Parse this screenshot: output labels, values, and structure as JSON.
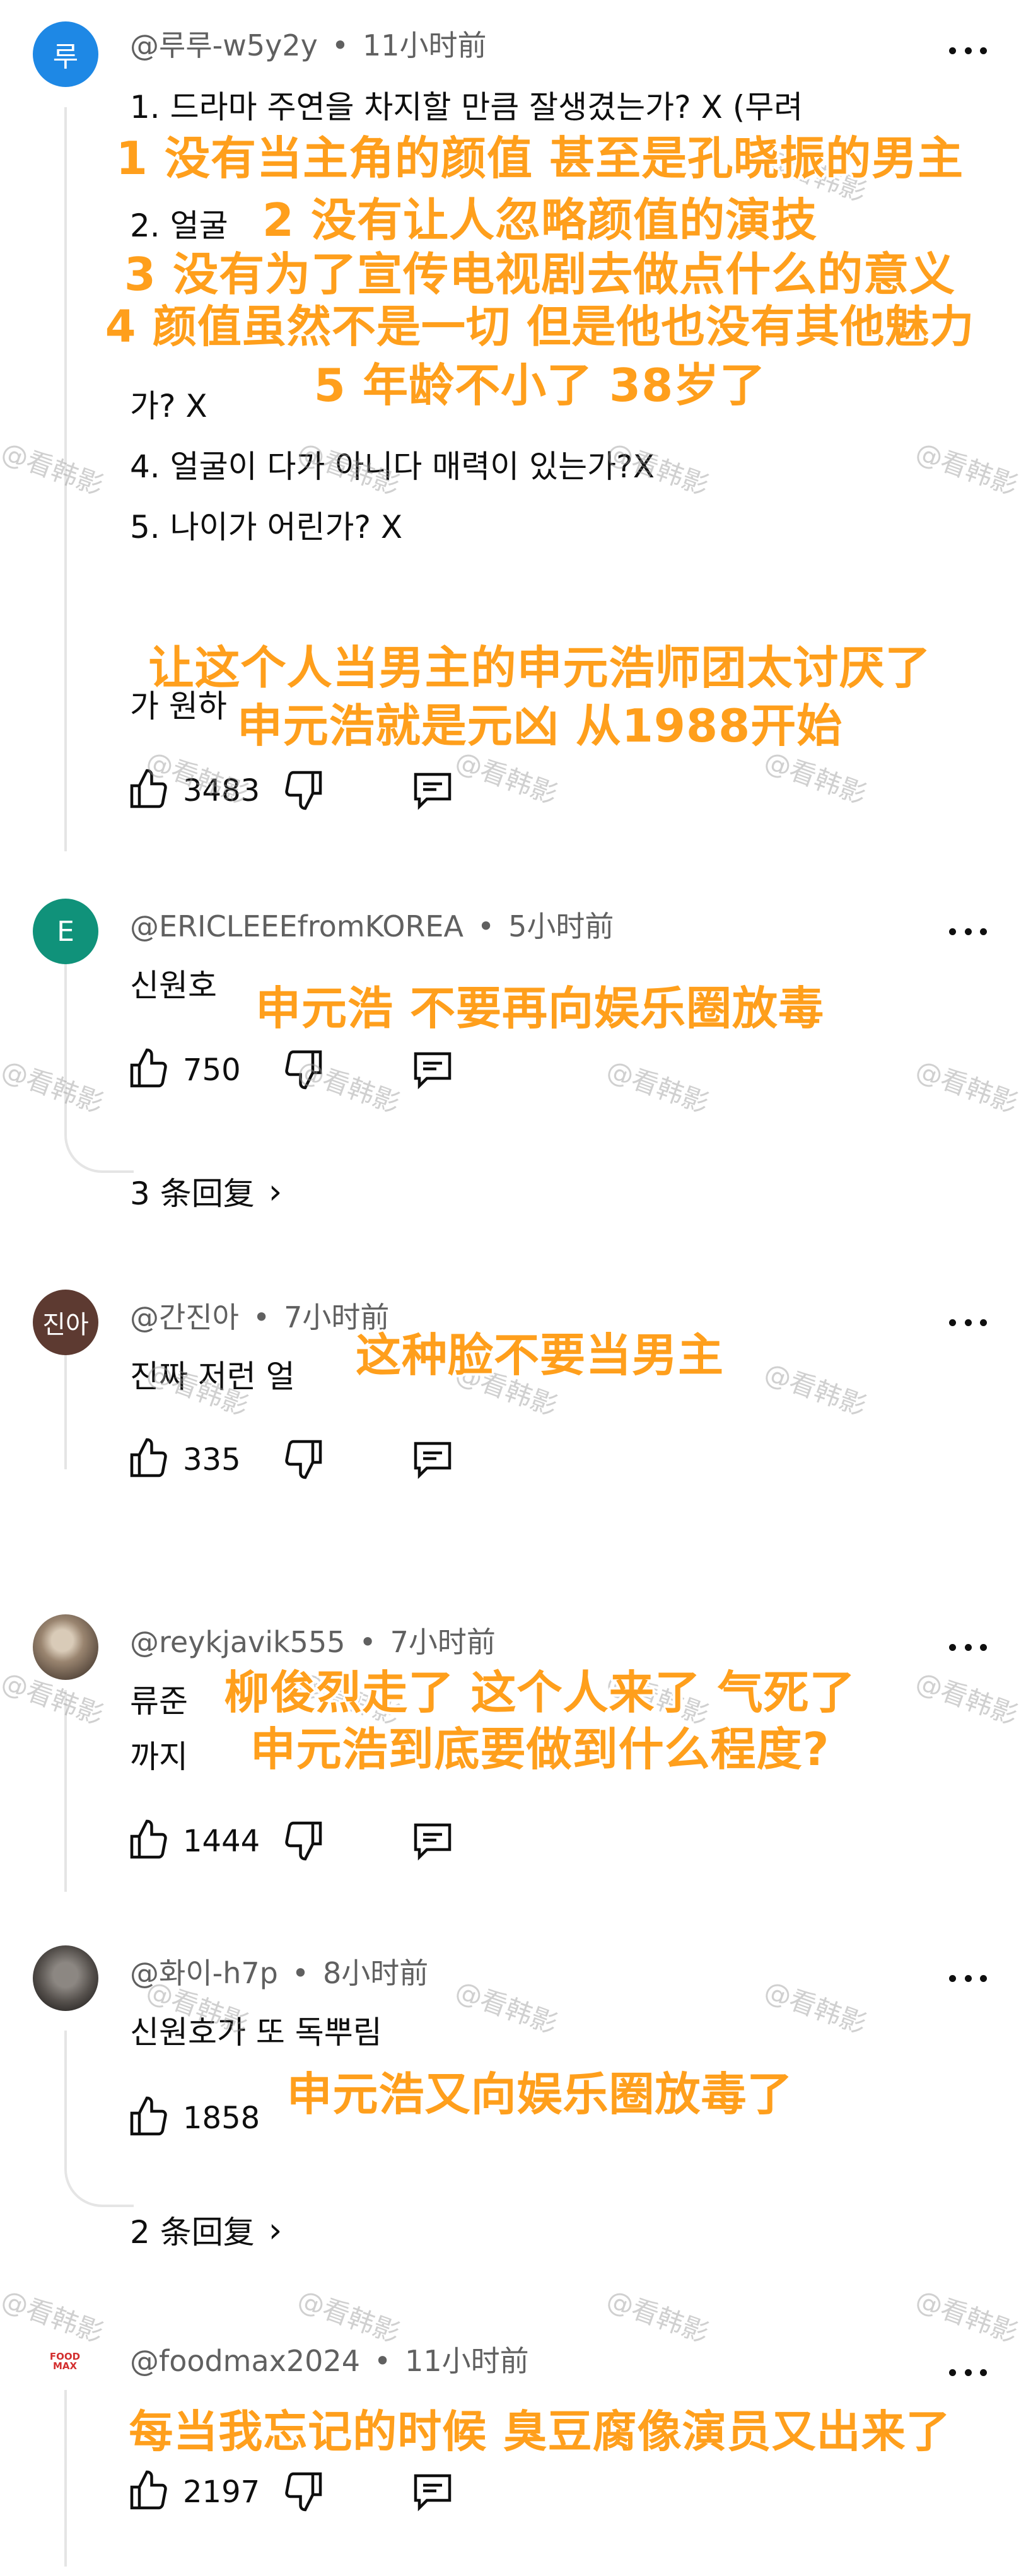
{
  "comments": [
    {
      "handle": "@루루-w5y2y",
      "time": "11小时前",
      "avatar_text": "루",
      "avatar_color": "#1e88e5",
      "body_lines": [
        "1. 드라마 주연을 차지할 만큼 잘생겼는가? X (무려",
        "2. 얼굴",
        "가? X",
        "4. 얼굴이 다가 아니다 매력이 있는가?X",
        "5. 나이가 어린가? X",
        "가 원하"
      ],
      "likes": "3483"
    },
    {
      "handle": "@ERICLEEEfromKOREA",
      "time": "5小时前",
      "avatar_text": "E",
      "avatar_color": "#10927a",
      "body_lines": [
        "신원호"
      ],
      "likes": "750",
      "replies": "3 条回复"
    },
    {
      "handle": "@간진아",
      "time": "7小时前",
      "avatar_text": "진아",
      "avatar_color": "#5d3a31",
      "body_lines": [
        "진짜 저런 얼"
      ],
      "likes": "335"
    },
    {
      "handle": "@reykjavik555",
      "time": "7小时前",
      "avatar_text": "",
      "avatar_color": "#8a7866",
      "body_lines": [
        "류준",
        "까지"
      ],
      "likes": "1444"
    },
    {
      "handle": "@화이-h7p",
      "time": "8小时前",
      "avatar_text": "",
      "avatar_color": "#6e6a66",
      "body_lines": [
        "신원호가 또 독뿌림"
      ],
      "likes": "1858",
      "replies": "2 条回复"
    },
    {
      "handle": "@foodmax2024",
      "time": "11小时前",
      "avatar_text": "FOOD MAX",
      "avatar_color": "#ffffff",
      "body_lines": [],
      "likes": "2197"
    }
  ],
  "overlays": [
    "1 没有当主角的颜值 甚至是孔晓振的男主",
    "2 没有让人忽略颜值的演技",
    "3 没有为了宣传电视剧去做点什么的意义",
    "4 颜值虽然不是一切 但是他也没有其他魅力",
    "5 年龄不小了 38岁了",
    "让这个人当男主的申元浩师团太讨厌了",
    "申元浩就是元凶 从1988开始",
    "申元浩 不要再向娱乐圈放毒",
    "这种脸不要当男主",
    "柳俊烈走了 这个人来了 气死了",
    "申元浩到底要做到什么程度?",
    "申元浩又向娱乐圈放毒了",
    "每当我忘记的时候 臭豆腐像演员又出来了"
  ],
  "watermark": "@看韩影",
  "dot": "•",
  "icons": {
    "like": "thumbs-up-icon",
    "dislike": "thumbs-down-icon",
    "reply": "reply-icon",
    "more": "more-vert-icon",
    "chevron": "chevron-right-icon"
  }
}
